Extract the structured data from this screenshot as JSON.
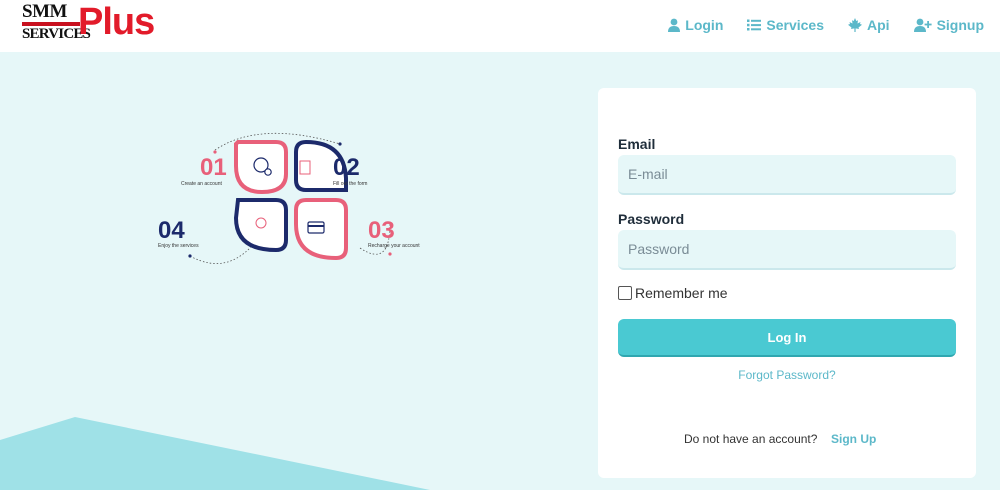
{
  "logo": {
    "line1": "SMM",
    "line2": "SERVICES",
    "accent": "Plus",
    "accent_color": "#e21b2a"
  },
  "nav": {
    "items": [
      {
        "label": "Login",
        "icon": "user-icon"
      },
      {
        "label": "Services",
        "icon": "list-icon"
      },
      {
        "label": "Api",
        "icon": "maple-leaf-icon"
      },
      {
        "label": "Signup",
        "icon": "user-plus-icon"
      }
    ]
  },
  "infographic": {
    "steps": [
      {
        "number": "01",
        "text": "Create an account",
        "color": "#e8607a"
      },
      {
        "number": "02",
        "text": "Fill out the form",
        "color": "#1c2a6b"
      },
      {
        "number": "03",
        "text": "Recharge your account",
        "color": "#e8607a"
      },
      {
        "number": "04",
        "text": "Enjoy the services",
        "color": "#1c2a6b"
      }
    ]
  },
  "form": {
    "email_label": "Email",
    "email_placeholder": "E-mail",
    "password_label": "Password",
    "password_placeholder": "Password",
    "remember_label": "Remember me",
    "login_button": "Log In",
    "forgot_link": "Forgot Password?",
    "no_account_text": "Do not have an account?",
    "signup_link": "Sign Up"
  },
  "colors": {
    "accent": "#4ac9d2",
    "link": "#5cb8c9",
    "background": "#e6f7f8",
    "wave": "#9fe1e7"
  }
}
